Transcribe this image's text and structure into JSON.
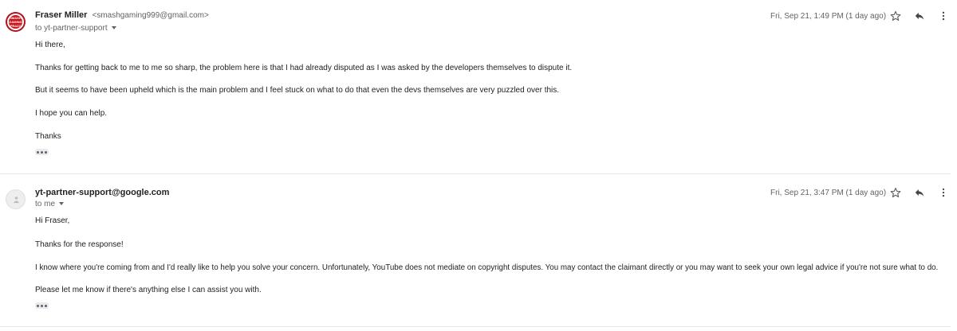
{
  "messages": [
    {
      "sender_name": "Fraser Miller",
      "sender_email": "<smashgaming999@gmail.com>",
      "to_line": "to yt-partner-support",
      "date": "Fri, Sep 21, 1:49 PM (1 day ago)",
      "avatar": "smash-gaming-logo",
      "avatar_text": "SMASH GAMING FRAZZ",
      "body": [
        "Hi there,",
        "Thanks for getting back to me to me so sharp, the problem here is that I had already disputed as I was asked by the developers themselves to dispute it.",
        "But it seems to have been upheld which is the main problem and I feel stuck on what to do that even the devs themselves are very puzzled over this.",
        "I hope you can help.",
        "Thanks"
      ]
    },
    {
      "sender_name": "yt-partner-support@google.com",
      "sender_email": "",
      "to_line": "to me",
      "date": "Fri, Sep 21, 3:47 PM (1 day ago)",
      "avatar": "default-avatar",
      "body": [
        "Hi Fraser,",
        "Thanks for the response!",
        "I know where you're coming from and I'd really like to help you solve your concern. Unfortunately, YouTube does not mediate on copyright disputes. You may contact the claimant directly or you may want to seek your own legal advice if you're not sure what to do.",
        "Please let me know if there's anything else I can assist you with."
      ]
    }
  ],
  "icons": {
    "star": "star-icon",
    "reply": "reply-icon",
    "more": "more-vert-icon",
    "expand": "show-trimmed-content-icon"
  },
  "colors": {
    "text": "#222222",
    "secondary": "#5f6368",
    "avatar_red": "#b3121a"
  }
}
